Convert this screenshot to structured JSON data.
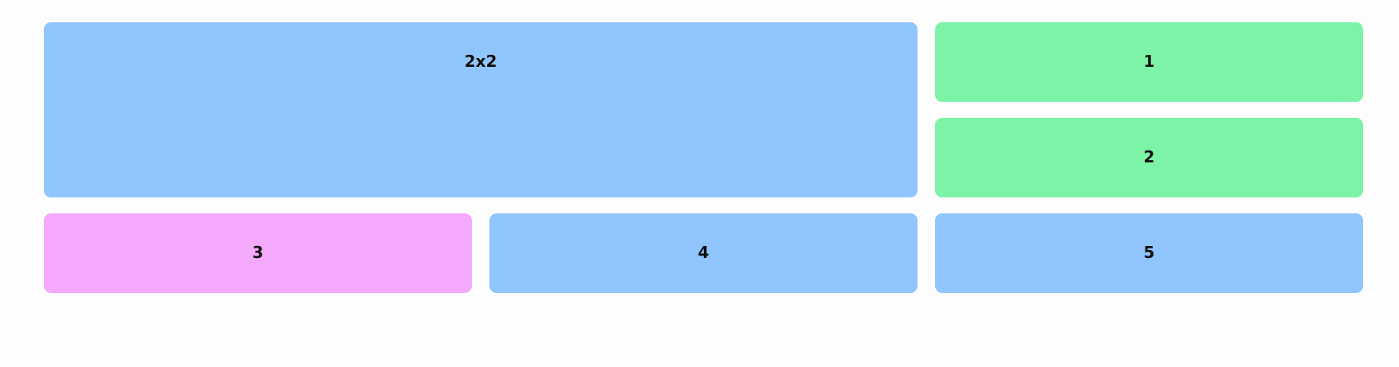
{
  "colors": {
    "blue": "#90c5fd",
    "green": "#7df3a7",
    "pink": "#f5a9fc"
  },
  "tiles": [
    {
      "label": "2x2",
      "color": "blue"
    },
    {
      "label": "1",
      "color": "green"
    },
    {
      "label": "2",
      "color": "green"
    },
    {
      "label": "3",
      "color": "pink"
    },
    {
      "label": "4",
      "color": "blue"
    },
    {
      "label": "5",
      "color": "blue"
    }
  ]
}
